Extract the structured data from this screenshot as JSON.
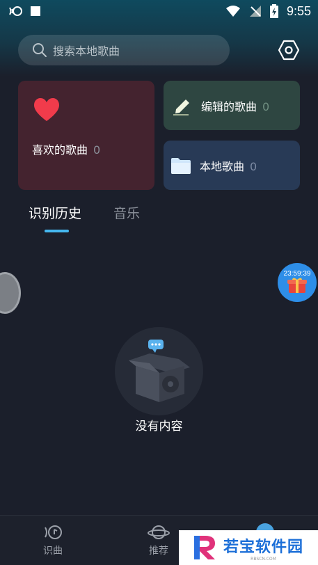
{
  "status_bar": {
    "time": "9:55"
  },
  "search": {
    "placeholder": "搜索本地歌曲"
  },
  "cards": {
    "favorites": {
      "label": "喜欢的歌曲",
      "count": "0"
    },
    "edited": {
      "label": "编辑的歌曲",
      "count": "0"
    },
    "local": {
      "label": "本地歌曲",
      "count": "0"
    }
  },
  "tabs": [
    {
      "label": "识别历史",
      "active": true
    },
    {
      "label": "音乐",
      "active": false
    }
  ],
  "gift": {
    "timer": "23:59:39"
  },
  "empty_state": {
    "text": "没有内容"
  },
  "bottom_nav": [
    {
      "label": "识曲",
      "icon": "recognize-icon"
    },
    {
      "label": "推荐",
      "icon": "planet-icon"
    }
  ],
  "watermark": {
    "title": "若宝软件园",
    "sub": "RBSCN.COM"
  },
  "colors": {
    "background": "#1b1f2b",
    "accent": "#45b7ef",
    "fav_card": "#44232f",
    "edit_card": "#2e4641",
    "local_card": "#283a56"
  }
}
